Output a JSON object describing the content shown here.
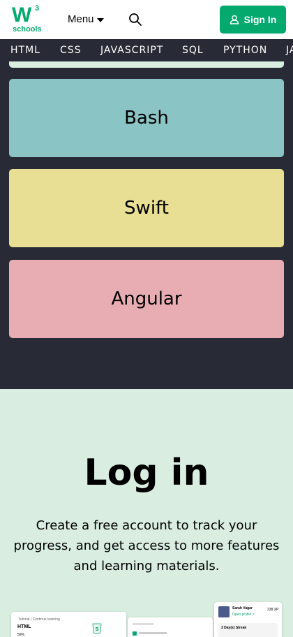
{
  "header": {
    "logo_text": "schools",
    "logo_mark": "W",
    "logo_sup": "3",
    "menu_label": "Menu",
    "signin_label": "Sign In",
    "accent": "#04aa6d"
  },
  "topnav": {
    "items": [
      "HTML",
      "CSS",
      "JAVASCRIPT",
      "SQL",
      "PYTHON",
      "JAVA"
    ]
  },
  "cards": [
    {
      "label": "Bash",
      "color": "#8ac4c4"
    },
    {
      "label": "Swift",
      "color": "#e8de94"
    },
    {
      "label": "Angular",
      "color": "#e8adb3"
    }
  ],
  "login": {
    "title": "Log in",
    "description": "Create a free account to track your progress, and get access to more features and learning materials."
  },
  "preview": {
    "tutorial_label": "Tutorial | Continue learning",
    "course": "HTML",
    "percent": "59%",
    "user_name": "Sarah Vagar",
    "profile_link": "Open profile >",
    "xp": "238 XP",
    "streak": "3 Day(s) Streak"
  }
}
